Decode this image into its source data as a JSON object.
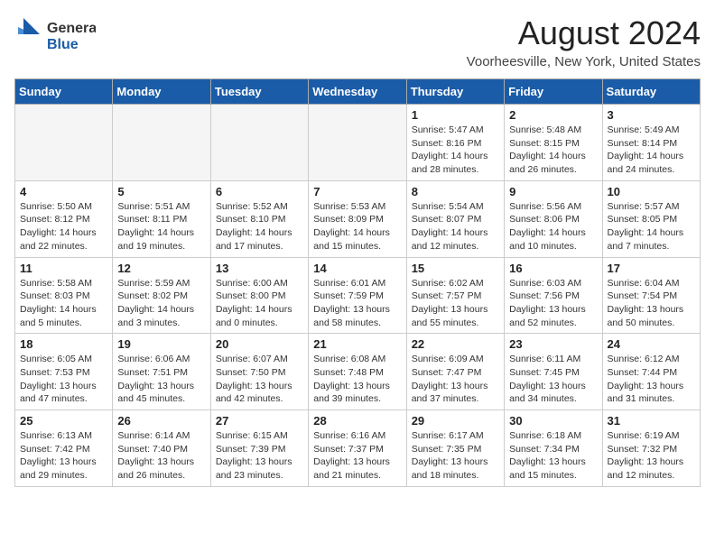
{
  "header": {
    "logo_line1": "General",
    "logo_line2": "Blue",
    "month_title": "August 2024",
    "location": "Voorheesville, New York, United States"
  },
  "days_of_week": [
    "Sunday",
    "Monday",
    "Tuesday",
    "Wednesday",
    "Thursday",
    "Friday",
    "Saturday"
  ],
  "weeks": [
    [
      {
        "day": "",
        "info": ""
      },
      {
        "day": "",
        "info": ""
      },
      {
        "day": "",
        "info": ""
      },
      {
        "day": "",
        "info": ""
      },
      {
        "day": "1",
        "info": "Sunrise: 5:47 AM\nSunset: 8:16 PM\nDaylight: 14 hours\nand 28 minutes."
      },
      {
        "day": "2",
        "info": "Sunrise: 5:48 AM\nSunset: 8:15 PM\nDaylight: 14 hours\nand 26 minutes."
      },
      {
        "day": "3",
        "info": "Sunrise: 5:49 AM\nSunset: 8:14 PM\nDaylight: 14 hours\nand 24 minutes."
      }
    ],
    [
      {
        "day": "4",
        "info": "Sunrise: 5:50 AM\nSunset: 8:12 PM\nDaylight: 14 hours\nand 22 minutes."
      },
      {
        "day": "5",
        "info": "Sunrise: 5:51 AM\nSunset: 8:11 PM\nDaylight: 14 hours\nand 19 minutes."
      },
      {
        "day": "6",
        "info": "Sunrise: 5:52 AM\nSunset: 8:10 PM\nDaylight: 14 hours\nand 17 minutes."
      },
      {
        "day": "7",
        "info": "Sunrise: 5:53 AM\nSunset: 8:09 PM\nDaylight: 14 hours\nand 15 minutes."
      },
      {
        "day": "8",
        "info": "Sunrise: 5:54 AM\nSunset: 8:07 PM\nDaylight: 14 hours\nand 12 minutes."
      },
      {
        "day": "9",
        "info": "Sunrise: 5:56 AM\nSunset: 8:06 PM\nDaylight: 14 hours\nand 10 minutes."
      },
      {
        "day": "10",
        "info": "Sunrise: 5:57 AM\nSunset: 8:05 PM\nDaylight: 14 hours\nand 7 minutes."
      }
    ],
    [
      {
        "day": "11",
        "info": "Sunrise: 5:58 AM\nSunset: 8:03 PM\nDaylight: 14 hours\nand 5 minutes."
      },
      {
        "day": "12",
        "info": "Sunrise: 5:59 AM\nSunset: 8:02 PM\nDaylight: 14 hours\nand 3 minutes."
      },
      {
        "day": "13",
        "info": "Sunrise: 6:00 AM\nSunset: 8:00 PM\nDaylight: 14 hours\nand 0 minutes."
      },
      {
        "day": "14",
        "info": "Sunrise: 6:01 AM\nSunset: 7:59 PM\nDaylight: 13 hours\nand 58 minutes."
      },
      {
        "day": "15",
        "info": "Sunrise: 6:02 AM\nSunset: 7:57 PM\nDaylight: 13 hours\nand 55 minutes."
      },
      {
        "day": "16",
        "info": "Sunrise: 6:03 AM\nSunset: 7:56 PM\nDaylight: 13 hours\nand 52 minutes."
      },
      {
        "day": "17",
        "info": "Sunrise: 6:04 AM\nSunset: 7:54 PM\nDaylight: 13 hours\nand 50 minutes."
      }
    ],
    [
      {
        "day": "18",
        "info": "Sunrise: 6:05 AM\nSunset: 7:53 PM\nDaylight: 13 hours\nand 47 minutes."
      },
      {
        "day": "19",
        "info": "Sunrise: 6:06 AM\nSunset: 7:51 PM\nDaylight: 13 hours\nand 45 minutes."
      },
      {
        "day": "20",
        "info": "Sunrise: 6:07 AM\nSunset: 7:50 PM\nDaylight: 13 hours\nand 42 minutes."
      },
      {
        "day": "21",
        "info": "Sunrise: 6:08 AM\nSunset: 7:48 PM\nDaylight: 13 hours\nand 39 minutes."
      },
      {
        "day": "22",
        "info": "Sunrise: 6:09 AM\nSunset: 7:47 PM\nDaylight: 13 hours\nand 37 minutes."
      },
      {
        "day": "23",
        "info": "Sunrise: 6:11 AM\nSunset: 7:45 PM\nDaylight: 13 hours\nand 34 minutes."
      },
      {
        "day": "24",
        "info": "Sunrise: 6:12 AM\nSunset: 7:44 PM\nDaylight: 13 hours\nand 31 minutes."
      }
    ],
    [
      {
        "day": "25",
        "info": "Sunrise: 6:13 AM\nSunset: 7:42 PM\nDaylight: 13 hours\nand 29 minutes."
      },
      {
        "day": "26",
        "info": "Sunrise: 6:14 AM\nSunset: 7:40 PM\nDaylight: 13 hours\nand 26 minutes."
      },
      {
        "day": "27",
        "info": "Sunrise: 6:15 AM\nSunset: 7:39 PM\nDaylight: 13 hours\nand 23 minutes."
      },
      {
        "day": "28",
        "info": "Sunrise: 6:16 AM\nSunset: 7:37 PM\nDaylight: 13 hours\nand 21 minutes."
      },
      {
        "day": "29",
        "info": "Sunrise: 6:17 AM\nSunset: 7:35 PM\nDaylight: 13 hours\nand 18 minutes."
      },
      {
        "day": "30",
        "info": "Sunrise: 6:18 AM\nSunset: 7:34 PM\nDaylight: 13 hours\nand 15 minutes."
      },
      {
        "day": "31",
        "info": "Sunrise: 6:19 AM\nSunset: 7:32 PM\nDaylight: 13 hours\nand 12 minutes."
      }
    ]
  ]
}
